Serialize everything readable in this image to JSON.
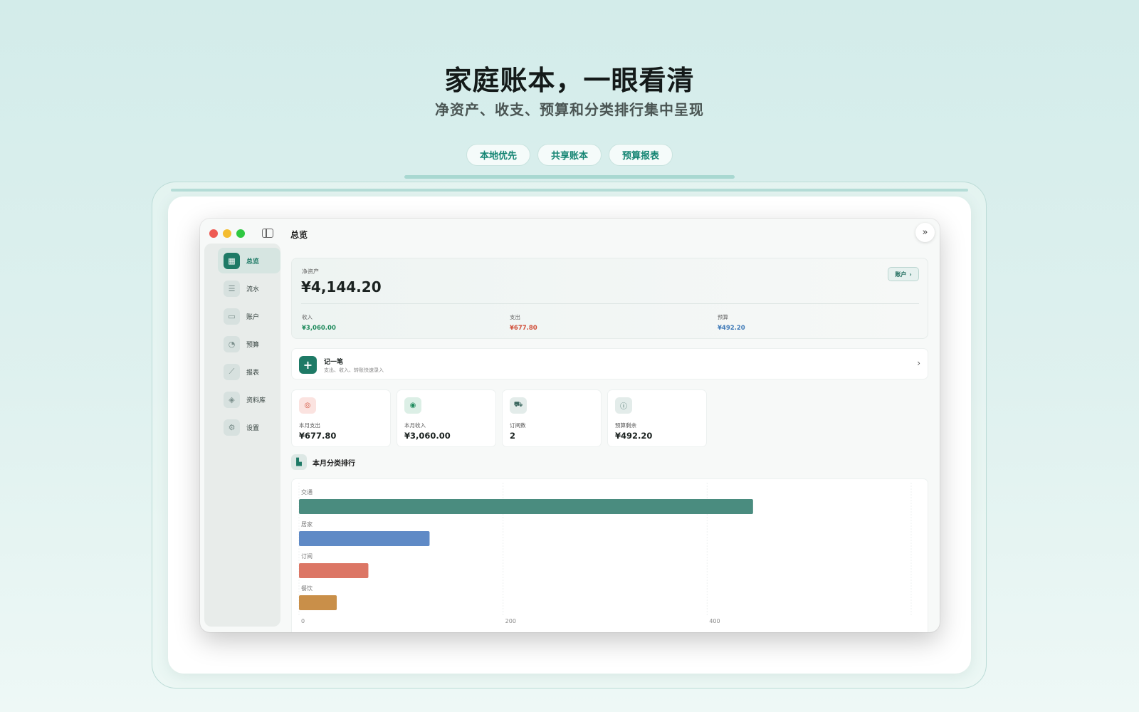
{
  "hero": {
    "title": "家庭账本，一眼看清",
    "subtitle": "净资产、收支、预算和分类排行集中呈现",
    "pills": [
      "本地优先",
      "共享账本",
      "预算报表"
    ]
  },
  "sidebar": {
    "items": [
      {
        "label": "总览",
        "icon": "grid-icon",
        "glyph": "▦"
      },
      {
        "label": "流水",
        "icon": "list-icon",
        "glyph": "☰"
      },
      {
        "label": "账户",
        "icon": "card-icon",
        "glyph": "▭"
      },
      {
        "label": "预算",
        "icon": "gauge-icon",
        "glyph": "◔"
      },
      {
        "label": "报表",
        "icon": "chart-icon",
        "glyph": "⟋"
      },
      {
        "label": "资料库",
        "icon": "stack-icon",
        "glyph": "◈"
      },
      {
        "label": "设置",
        "icon": "gear-icon",
        "glyph": "⚙"
      }
    ]
  },
  "header": {
    "title": "总览",
    "expand_glyph": "»"
  },
  "net_worth": {
    "label": "净资产",
    "value": "¥4,144.20",
    "account_button": "账户",
    "chevron": "›",
    "stats": [
      {
        "label": "收入",
        "value": "¥3,060.00",
        "color": "#1e8a5c"
      },
      {
        "label": "支出",
        "value": "¥677.80",
        "color": "#d1503a"
      },
      {
        "label": "预算",
        "value": "¥492.20",
        "color": "#3f7ab8"
      }
    ]
  },
  "quick_add": {
    "icon": "+",
    "title": "记一笔",
    "subtitle": "支出、收入、转账快速录入",
    "chevron": "›"
  },
  "stat_cards": [
    {
      "label": "本月支出",
      "value": "¥677.80",
      "icon": "target-icon",
      "glyph": "◎",
      "icon_bg": "#fbe3e0",
      "icon_color": "#d1503a"
    },
    {
      "label": "本月收入",
      "value": "¥3,060.00",
      "icon": "play-circle-icon",
      "glyph": "◉",
      "icon_bg": "#dcefe6",
      "icon_color": "#1e8a5c"
    },
    {
      "label": "订阅数",
      "value": "2",
      "icon": "car-icon",
      "glyph": "⛟",
      "icon_bg": "#e3ecea",
      "icon_color": "#3c6860"
    },
    {
      "label": "预算剩余",
      "value": "¥492.20",
      "icon": "info-icon",
      "glyph": "ⓘ",
      "icon_bg": "#e3ecea",
      "icon_color": "#3c6860"
    }
  ],
  "ranking": {
    "title": "本月分类排行",
    "icon_glyph": "▙"
  },
  "chart_data": {
    "type": "bar",
    "orientation": "horizontal",
    "categories": [
      "交通",
      "居家",
      "订阅",
      "餐饮"
    ],
    "values": [
      445,
      128,
      68,
      37
    ],
    "colors": [
      "#4a8c7f",
      "#5f8ac6",
      "#dc7665",
      "#c98f49"
    ],
    "x_ticks": [
      0,
      200,
      400
    ],
    "xlim": [
      0,
      600
    ],
    "grid": true
  }
}
